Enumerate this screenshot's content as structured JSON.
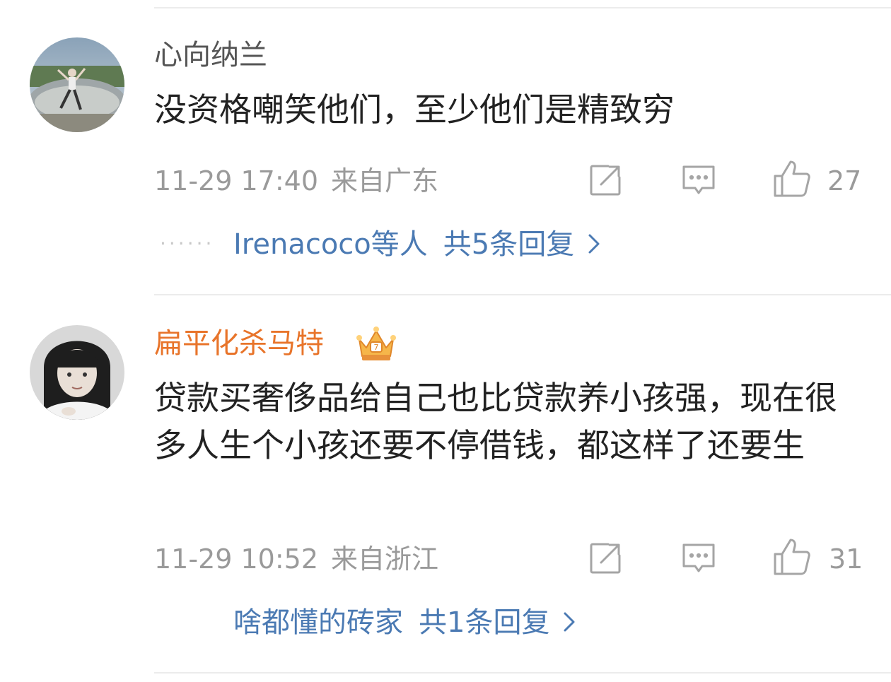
{
  "comments": [
    {
      "username": "心向纳兰",
      "text": "没资格嘲笑他们，至少他们是精致穷",
      "time": "11-29 17:40",
      "location": "来自广东",
      "likes": "27",
      "reply_names": "Irenacoco等人",
      "reply_count": "共5条回复",
      "avatar_icon": "photo-avatar-person-sculpture",
      "name_color": "#555555"
    },
    {
      "username": "扁平化杀马特",
      "text": "贷款买奢侈品给自己也比贷款养小孩强，现在很多人生个小孩还要不停借钱，都这样了还要生",
      "time": "11-29 10:52",
      "location": "来自浙江",
      "likes": "31",
      "reply_names": "啥都懂的砖家",
      "reply_count": "共1条回复",
      "avatar_icon": "photo-avatar-girl",
      "badge_icon": "crown-vip-icon",
      "name_color": "#e8742a"
    }
  ],
  "icons": {
    "repost": "repost-icon",
    "comment": "comment-icon",
    "like": "like-icon",
    "more_arrow": "chevron-right-icon"
  },
  "colors": {
    "link": "#4b7ab3",
    "meta": "#9a9a9a",
    "vip_name": "#e8742a"
  }
}
